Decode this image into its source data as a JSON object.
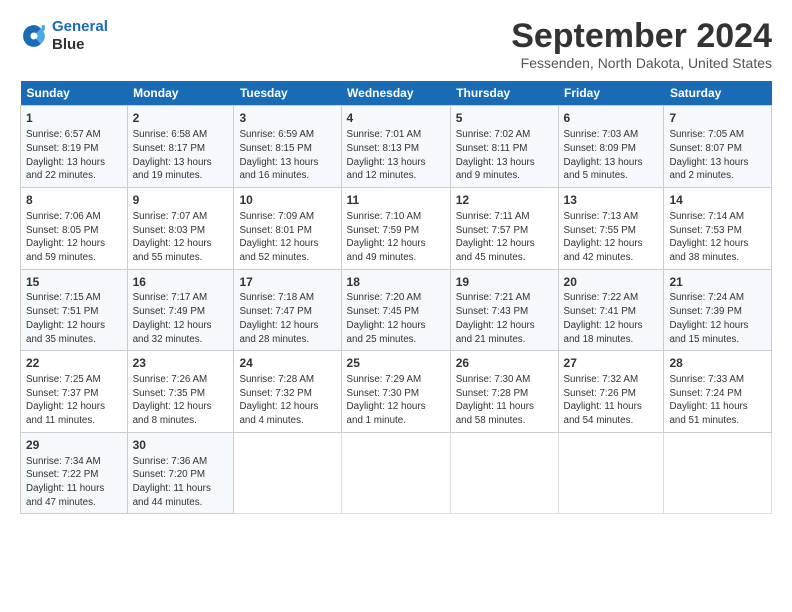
{
  "header": {
    "logo_line1": "General",
    "logo_line2": "Blue",
    "month_title": "September 2024",
    "location": "Fessenden, North Dakota, United States"
  },
  "days_of_week": [
    "Sunday",
    "Monday",
    "Tuesday",
    "Wednesday",
    "Thursday",
    "Friday",
    "Saturday"
  ],
  "weeks": [
    [
      {
        "day": "1",
        "detail": "Sunrise: 6:57 AM\nSunset: 8:19 PM\nDaylight: 13 hours\nand 22 minutes."
      },
      {
        "day": "2",
        "detail": "Sunrise: 6:58 AM\nSunset: 8:17 PM\nDaylight: 13 hours\nand 19 minutes."
      },
      {
        "day": "3",
        "detail": "Sunrise: 6:59 AM\nSunset: 8:15 PM\nDaylight: 13 hours\nand 16 minutes."
      },
      {
        "day": "4",
        "detail": "Sunrise: 7:01 AM\nSunset: 8:13 PM\nDaylight: 13 hours\nand 12 minutes."
      },
      {
        "day": "5",
        "detail": "Sunrise: 7:02 AM\nSunset: 8:11 PM\nDaylight: 13 hours\nand 9 minutes."
      },
      {
        "day": "6",
        "detail": "Sunrise: 7:03 AM\nSunset: 8:09 PM\nDaylight: 13 hours\nand 5 minutes."
      },
      {
        "day": "7",
        "detail": "Sunrise: 7:05 AM\nSunset: 8:07 PM\nDaylight: 13 hours\nand 2 minutes."
      }
    ],
    [
      {
        "day": "8",
        "detail": "Sunrise: 7:06 AM\nSunset: 8:05 PM\nDaylight: 12 hours\nand 59 minutes."
      },
      {
        "day": "9",
        "detail": "Sunrise: 7:07 AM\nSunset: 8:03 PM\nDaylight: 12 hours\nand 55 minutes."
      },
      {
        "day": "10",
        "detail": "Sunrise: 7:09 AM\nSunset: 8:01 PM\nDaylight: 12 hours\nand 52 minutes."
      },
      {
        "day": "11",
        "detail": "Sunrise: 7:10 AM\nSunset: 7:59 PM\nDaylight: 12 hours\nand 49 minutes."
      },
      {
        "day": "12",
        "detail": "Sunrise: 7:11 AM\nSunset: 7:57 PM\nDaylight: 12 hours\nand 45 minutes."
      },
      {
        "day": "13",
        "detail": "Sunrise: 7:13 AM\nSunset: 7:55 PM\nDaylight: 12 hours\nand 42 minutes."
      },
      {
        "day": "14",
        "detail": "Sunrise: 7:14 AM\nSunset: 7:53 PM\nDaylight: 12 hours\nand 38 minutes."
      }
    ],
    [
      {
        "day": "15",
        "detail": "Sunrise: 7:15 AM\nSunset: 7:51 PM\nDaylight: 12 hours\nand 35 minutes."
      },
      {
        "day": "16",
        "detail": "Sunrise: 7:17 AM\nSunset: 7:49 PM\nDaylight: 12 hours\nand 32 minutes."
      },
      {
        "day": "17",
        "detail": "Sunrise: 7:18 AM\nSunset: 7:47 PM\nDaylight: 12 hours\nand 28 minutes."
      },
      {
        "day": "18",
        "detail": "Sunrise: 7:20 AM\nSunset: 7:45 PM\nDaylight: 12 hours\nand 25 minutes."
      },
      {
        "day": "19",
        "detail": "Sunrise: 7:21 AM\nSunset: 7:43 PM\nDaylight: 12 hours\nand 21 minutes."
      },
      {
        "day": "20",
        "detail": "Sunrise: 7:22 AM\nSunset: 7:41 PM\nDaylight: 12 hours\nand 18 minutes."
      },
      {
        "day": "21",
        "detail": "Sunrise: 7:24 AM\nSunset: 7:39 PM\nDaylight: 12 hours\nand 15 minutes."
      }
    ],
    [
      {
        "day": "22",
        "detail": "Sunrise: 7:25 AM\nSunset: 7:37 PM\nDaylight: 12 hours\nand 11 minutes."
      },
      {
        "day": "23",
        "detail": "Sunrise: 7:26 AM\nSunset: 7:35 PM\nDaylight: 12 hours\nand 8 minutes."
      },
      {
        "day": "24",
        "detail": "Sunrise: 7:28 AM\nSunset: 7:32 PM\nDaylight: 12 hours\nand 4 minutes."
      },
      {
        "day": "25",
        "detail": "Sunrise: 7:29 AM\nSunset: 7:30 PM\nDaylight: 12 hours\nand 1 minute."
      },
      {
        "day": "26",
        "detail": "Sunrise: 7:30 AM\nSunset: 7:28 PM\nDaylight: 11 hours\nand 58 minutes."
      },
      {
        "day": "27",
        "detail": "Sunrise: 7:32 AM\nSunset: 7:26 PM\nDaylight: 11 hours\nand 54 minutes."
      },
      {
        "day": "28",
        "detail": "Sunrise: 7:33 AM\nSunset: 7:24 PM\nDaylight: 11 hours\nand 51 minutes."
      }
    ],
    [
      {
        "day": "29",
        "detail": "Sunrise: 7:34 AM\nSunset: 7:22 PM\nDaylight: 11 hours\nand 47 minutes."
      },
      {
        "day": "30",
        "detail": "Sunrise: 7:36 AM\nSunset: 7:20 PM\nDaylight: 11 hours\nand 44 minutes."
      },
      {
        "day": "",
        "detail": ""
      },
      {
        "day": "",
        "detail": ""
      },
      {
        "day": "",
        "detail": ""
      },
      {
        "day": "",
        "detail": ""
      },
      {
        "day": "",
        "detail": ""
      }
    ]
  ]
}
